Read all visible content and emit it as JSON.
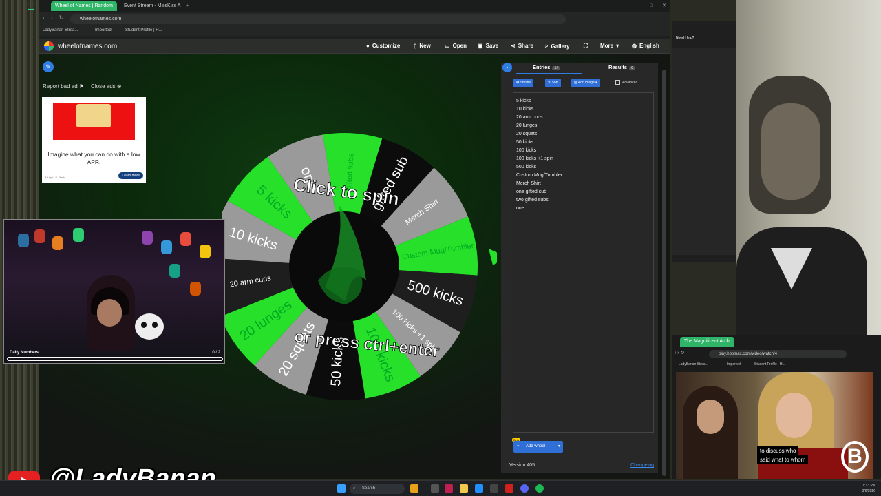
{
  "browser": {
    "tabs": [
      "Wheel of Names | Random",
      "Event Stream - MissKiss A"
    ],
    "url": "wheelofnames.com",
    "bookmarks": [
      "LadyBanan Strea...",
      "Imported",
      "Student Profile | H..."
    ]
  },
  "site": {
    "brand": "wheelofnames.com",
    "nav": [
      "Customize",
      "New",
      "Open",
      "Save",
      "Share",
      "Gallery",
      "More",
      "English"
    ],
    "report_ad": "Report bad ad",
    "close_ads": "Close ads"
  },
  "ad": {
    "headline": "Imagine what you can do with a low APR.",
    "cta": "Learn more",
    "advertiser": "Ad by U.S. Bank"
  },
  "wheel": {
    "center_text_top": "Click to spin",
    "center_text_bottom": "or press ctrl+enter",
    "segments": [
      "one",
      "gifted subs",
      "gifted sub",
      "Merch Shirt",
      "Custom Mug/Tumbler",
      "500 kicks",
      "100 kicks +1 spin",
      "100 kicks",
      "50 kicks",
      "20 squats",
      "20 lunges",
      "20 arm curls",
      "10 kicks",
      "5 kicks"
    ],
    "colors": {
      "green": "#26e02a",
      "dark": "#1e1e1e",
      "gray": "#9a9a9a",
      "black": "#0c0c0c"
    }
  },
  "panel": {
    "tab_entries": "Entries",
    "entries_count": "14",
    "tab_results": "Results",
    "results_count": "0",
    "buttons": [
      "Shuffle",
      "Sort",
      "Add image"
    ],
    "advanced_label": "Advanced",
    "entries": [
      "5 kicks",
      "10 kicks",
      "20 arm curls",
      "20 lunges",
      "20 squats",
      "50 kicks",
      "100 kicks",
      "100 kicks +1 spin",
      "500 kicks",
      "Custom Mug/Tumbler",
      "Merch Shirt",
      "one gifted sub",
      "two gifted subs",
      "one"
    ],
    "beta": "Beta",
    "add_wheel": "Add wheel",
    "version": "Version 405",
    "changelog": "Changelog"
  },
  "webcam": {
    "label": "Daily Numbers",
    "count": "0 / 2"
  },
  "stream": {
    "handle": "@LadyBanan"
  },
  "side_window": {
    "need_help": "Need Help?"
  },
  "media_window": {
    "tab": "The Magnificent Archi",
    "url": "play.hbomax.com/video/watch/4",
    "bookmarks": [
      "LadyBanan Strea...",
      "Imported",
      "Student Profile | H..."
    ],
    "subtitle_line1": "to discuss who",
    "subtitle_line2": "said what to whom"
  },
  "taskbar": {
    "search": "Search",
    "time": "1:13 PM",
    "date": "3/6/2026"
  }
}
